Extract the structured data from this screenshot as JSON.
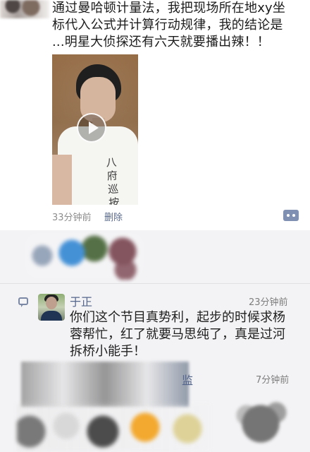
{
  "post": {
    "text_lines": [
      "通过曼哈顿计量法，我把现场所在地xy坐",
      "标代入公式并计算行动规律，我的结论是",
      "...明星大侦探还有六天就要播出辣！！"
    ],
    "video_shirt_text": "八\n府\n巡\n按",
    "time": "33分钟前",
    "delete_label": "删除"
  },
  "comment": {
    "name": "于正",
    "time": "23分钟前",
    "lines": [
      "你们这个节目真势利，起步的时候求杨",
      "蓉帮忙，红了就要马思纯了，真是过河",
      "拆桥小能手！"
    ]
  },
  "comment2": {
    "name_suffix": "监",
    "time": "7分钟前"
  }
}
